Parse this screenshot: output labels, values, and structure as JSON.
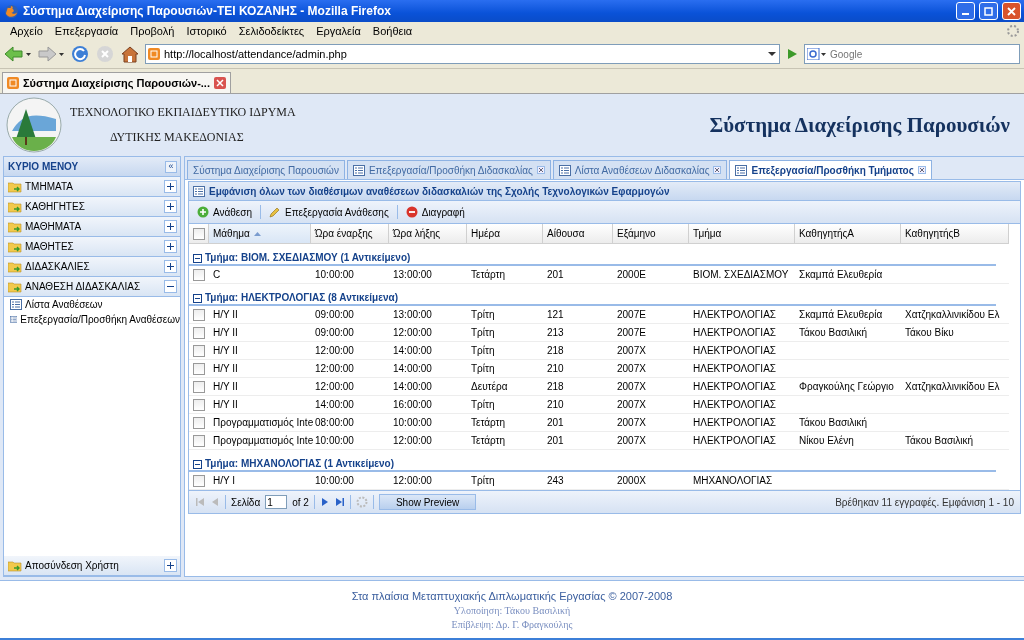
{
  "window": {
    "title": "Σύστημα Διαχείρισης Παρουσιών-ΤΕΙ ΚΟΖΑΝΗΣ - Mozilla Firefox"
  },
  "menu": [
    "Αρχείο",
    "Επεξεργασία",
    "Προβολή",
    "Ιστορικό",
    "Σελιδοδείκτες",
    "Εργαλεία",
    "Βοήθεια"
  ],
  "address": {
    "url": "http://localhost/attendance/admin.php"
  },
  "search": {
    "placeholder": "Google"
  },
  "browser_tabs": [
    {
      "label": "Σύστημα Διαχείρισης Παρουσιών-...",
      "selected": true
    }
  ],
  "header": {
    "org_line1": "ΤΕΧΝΟΛΟΓΙΚΟ ΕΚΠΑΙΔΕΥΤΙΚΟ ΙΔΡΥΜΑ",
    "org_line2": "ΔΥΤΙΚΗΣ ΜΑΚΕΔΟΝΙΑΣ",
    "app_title": "Σύστημα Διαχείρισης Παρουσιών"
  },
  "sidebar": {
    "title": "ΚΥΡΙΟ ΜΕΝΟΥ",
    "collapse": "«",
    "sections": [
      {
        "label": "ΤΜΗΜΑΤΑ",
        "expanded": false
      },
      {
        "label": "ΚΑΘΗΓΗΤΕΣ",
        "expanded": false
      },
      {
        "label": "ΜΑΘΗΜΑΤΑ",
        "expanded": false
      },
      {
        "label": "ΜΑΘΗΤΕΣ",
        "expanded": false
      },
      {
        "label": "ΔΙΔΑΣΚΑΛΙΕΣ",
        "expanded": false
      },
      {
        "label": "ΑΝΑΘΕΣΗ ΔΙΔΑΣΚΑΛΙΑΣ",
        "expanded": true,
        "children": [
          {
            "label": "Λίστα Αναθέσεων"
          },
          {
            "label": "Επεξεργασία/Προσθήκη Αναθέσεων"
          }
        ]
      }
    ],
    "bottom": {
      "label": "Αποσύνδεση Χρήστη",
      "expanded": false
    }
  },
  "tabs": [
    {
      "label": "Σύστημα Διαχείρισης Παρουσιών",
      "selected": false,
      "closable": false
    },
    {
      "label": "Επεξεργασία/Προσθήκη Διδασκαλίας",
      "selected": false,
      "closable": true
    },
    {
      "label": "Λίστα Αναθέσεων Διδασκαλίας",
      "selected": false,
      "closable": true
    },
    {
      "label": "Επεξεργασία/Προσθήκη Τμήματος",
      "selected": true,
      "closable": true
    }
  ],
  "panel": {
    "title": "Εμφάνιση όλων των διαθέσιμων αναθέσεων διδασκαλιών της Σχολής Τεχνολογικών Εφαρμογών",
    "toolbar": [
      {
        "label": "Ανάθεση",
        "kind": "add"
      },
      {
        "label": "Επεξεργασία Ανάθεσης",
        "kind": "edit"
      },
      {
        "label": "Διαγραφή",
        "kind": "delete"
      }
    ],
    "all_checked": false,
    "columns": [
      {
        "label": "Μάθημα",
        "sorted": true
      },
      {
        "label": "Ώρα έναρξης",
        "sorted": false
      },
      {
        "label": "Ώρα λήξης",
        "sorted": false
      },
      {
        "label": "Ημέρα",
        "sorted": false
      },
      {
        "label": "Αίθουσα",
        "sorted": false
      },
      {
        "label": "Εξάμηνο",
        "sorted": false
      },
      {
        "label": "Τμήμα",
        "sorted": false
      },
      {
        "label": "ΚαθηγητήςA",
        "sorted": false
      },
      {
        "label": "ΚαθηγητήςB",
        "sorted": false
      }
    ],
    "groups": [
      {
        "title": "Τμήμα: ΒΙΟΜ. ΣΧΕΔΙΑΣΜΟΥ (1 Αντικείμενο)",
        "expanded": true,
        "rows": [
          {
            "checked": false,
            "cells": [
              "C",
              "10:00:00",
              "13:00:00",
              "Τετάρτη",
              "201",
              "2000E",
              "ΒΙΟΜ. ΣΧΕΔΙΑΣΜΟΥ",
              "Σκαμπά Ελευθερία",
              ""
            ]
          }
        ]
      },
      {
        "title": "Τμήμα: ΗΛΕΚΤΡΟΛΟΓΙΑΣ (8 Αντικείμενα)",
        "expanded": true,
        "rows": [
          {
            "checked": false,
            "cells": [
              "Η/Υ ΙΙ",
              "09:00:00",
              "13:00:00",
              "Τρίτη",
              "121",
              "2007E",
              "ΗΛΕΚΤΡΟΛΟΓΙΑΣ",
              "Σκαμπά Ελευθερία",
              "Χατζηκαλλινικίδου Ελ"
            ]
          },
          {
            "checked": false,
            "cells": [
              "Η/Υ ΙΙ",
              "09:00:00",
              "12:00:00",
              "Τρίτη",
              "213",
              "2007E",
              "ΗΛΕΚΤΡΟΛΟΓΙΑΣ",
              "Τάκου Βασιλική",
              "Τάκου Βίκυ"
            ]
          },
          {
            "checked": false,
            "cells": [
              "Η/Υ ΙΙ",
              "12:00:00",
              "14:00:00",
              "Τρίτη",
              "218",
              "2007X",
              "ΗΛΕΚΤΡΟΛΟΓΙΑΣ",
              "",
              ""
            ]
          },
          {
            "checked": false,
            "cells": [
              "Η/Υ ΙΙ",
              "12:00:00",
              "14:00:00",
              "Τρίτη",
              "210",
              "2007X",
              "ΗΛΕΚΤΡΟΛΟΓΙΑΣ",
              "",
              ""
            ]
          },
          {
            "checked": false,
            "cells": [
              "Η/Υ ΙΙ",
              "12:00:00",
              "14:00:00",
              "Δευτέρα",
              "218",
              "2007X",
              "ΗΛΕΚΤΡΟΛΟΓΙΑΣ",
              "Φραγκούλης Γεώργιο",
              "Χατζηκαλλινικίδου Ελ"
            ]
          },
          {
            "checked": false,
            "cells": [
              "Η/Υ ΙΙ",
              "14:00:00",
              "16:00:00",
              "Τρίτη",
              "210",
              "2007X",
              "ΗΛΕΚΤΡΟΛΟΓΙΑΣ",
              "",
              ""
            ]
          },
          {
            "checked": false,
            "cells": [
              "Προγραμματισμός Inte",
              "08:00:00",
              "10:00:00",
              "Τετάρτη",
              "201",
              "2007X",
              "ΗΛΕΚΤΡΟΛΟΓΙΑΣ",
              "Τάκου Βασιλική",
              ""
            ]
          },
          {
            "checked": false,
            "cells": [
              "Προγραμματισμός Inte",
              "10:00:00",
              "12:00:00",
              "Τετάρτη",
              "201",
              "2007X",
              "ΗΛΕΚΤΡΟΛΟΓΙΑΣ",
              "Νίκου Ελένη",
              "Τάκου Βασιλική"
            ]
          }
        ]
      },
      {
        "title": "Τμήμα: ΜΗΧΑΝΟΛΟΓΙΑΣ (1 Αντικείμενο)",
        "expanded": true,
        "rows": [
          {
            "checked": false,
            "cells": [
              "Η/Υ Ι",
              "10:00:00",
              "12:00:00",
              "Τρίτη",
              "243",
              "2000X",
              "ΜΗΧΑΝΟΛΟΓΙΑΣ",
              "",
              ""
            ]
          }
        ]
      }
    ],
    "pager": {
      "page_label": "Σελίδα",
      "page": "1",
      "of": "of 2",
      "preview": "Show Preview",
      "status": "Βρέθηκαν 11 εγγραφές. Εμφάνιση 1 - 10"
    }
  },
  "footer": [
    "Στα πλαίσια Μεταπτυχιακής Διπλωματικής Εργασίας © 2007-2008",
    "Υλοποίηση: Τάκου Βασιλική",
    "Επίβλεψη: Δρ. Γ. Φραγκούλης"
  ]
}
